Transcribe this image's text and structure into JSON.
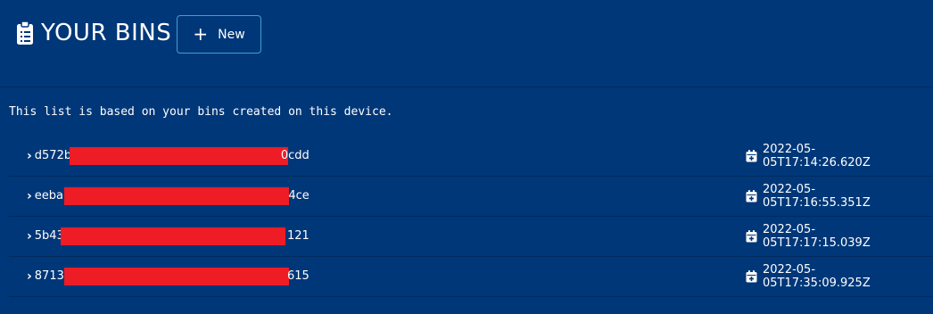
{
  "header": {
    "title": "YOUR BINS",
    "title_icon": "clipboard-list-icon",
    "new_button": {
      "label": "New",
      "icon": "plus-icon",
      "icon_glyph": "+"
    }
  },
  "info_text": "This list is based on your bins created on this device.",
  "bins": [
    {
      "id_prefix": "d572b",
      "id_suffix": "0cdd",
      "created": "2022-05-05T17:14:26.620Z"
    },
    {
      "id_prefix": "eeba",
      "id_suffix": "4ce",
      "created": "2022-05-05T17:16:55.351Z"
    },
    {
      "id_prefix": "5b43",
      "id_suffix": "121",
      "created": "2022-05-05T17:17:15.039Z"
    },
    {
      "id_prefix": "8713",
      "id_suffix": "615",
      "created": "2022-05-05T17:35:09.925Z"
    }
  ],
  "chevron_glyph": "›",
  "colors": {
    "background": "#003778",
    "redaction": "#ee1c25",
    "button_border": "#3f9fd8",
    "divider": "#002a5e"
  }
}
